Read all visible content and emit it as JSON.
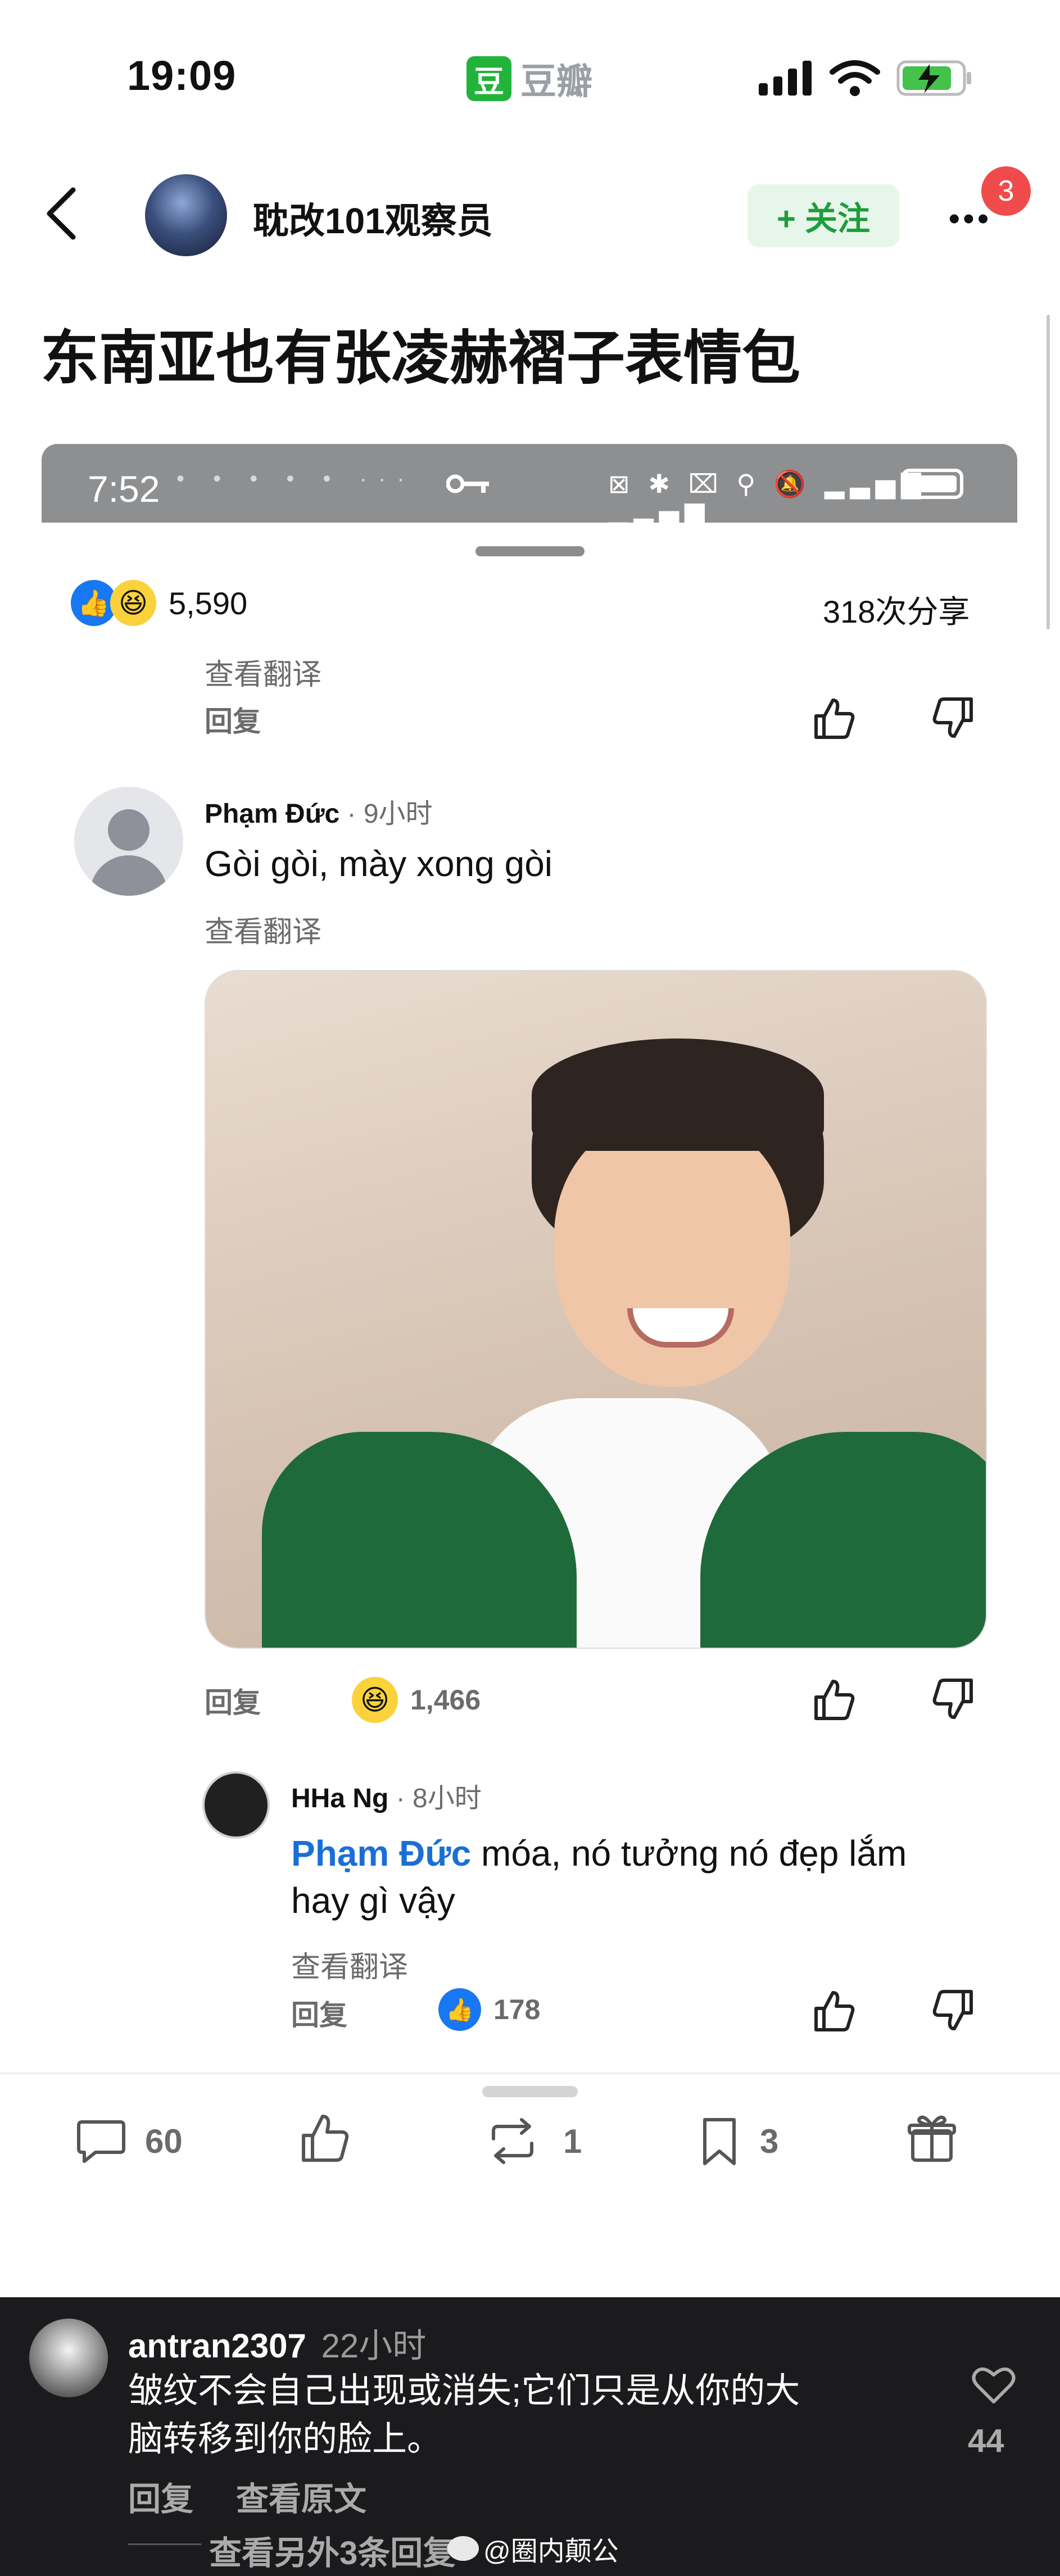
{
  "status_bar": {
    "time": "19:09",
    "app_name": "豆瓣",
    "app_logo_char": "豆"
  },
  "header": {
    "username": "耽改101观察员",
    "follow_label": "+ 关注",
    "more_icon": "more-icon",
    "badge_count": "3"
  },
  "post": {
    "title": "东南亚也有张凌赫褶子表情包"
  },
  "screenshot_status": {
    "time": "7:52",
    "dots": "• • • • • ···"
  },
  "summary": {
    "reaction_count": "5,590",
    "share_text": "318次分享",
    "translate": "查看翻译",
    "reply": "回复"
  },
  "comment1": {
    "author": "Phạm Đức",
    "time": "· 9小时",
    "text": "Gòi gòi, mày xong gòi",
    "translate": "查看翻译",
    "reply": "回复",
    "reaction_count": "1,466"
  },
  "comment2": {
    "author": "HHa Ng",
    "time": "· 8小时",
    "mention": "Phạm Đức",
    "text": " móa, nó tưởng nó đẹp lắm",
    "text2": "hay gì vậy",
    "translate": "查看翻译",
    "reply": "回复",
    "reaction_count": "178"
  },
  "bottom_bar": {
    "comments": "60",
    "reposts": "1",
    "bookmarks": "3"
  },
  "overlay_comment": {
    "username": "antran2307",
    "time": "22小时",
    "text_line1": "皱纹不会自己出现或消失;它们只是从你的大",
    "text_line2": "脑转移到你的脸上。",
    "like_count": "44",
    "reply": "回复",
    "view_original": "查看原文",
    "more_replies": "查看另外3条回复",
    "watermark": "@圈内颠公"
  },
  "colors": {
    "accent_green": "#22b33a",
    "follow_bg": "#e7f6ea",
    "link_blue": "#1a6fd6",
    "badge_red": "#ef4b4b",
    "dark_panel": "#1b1b1d"
  }
}
